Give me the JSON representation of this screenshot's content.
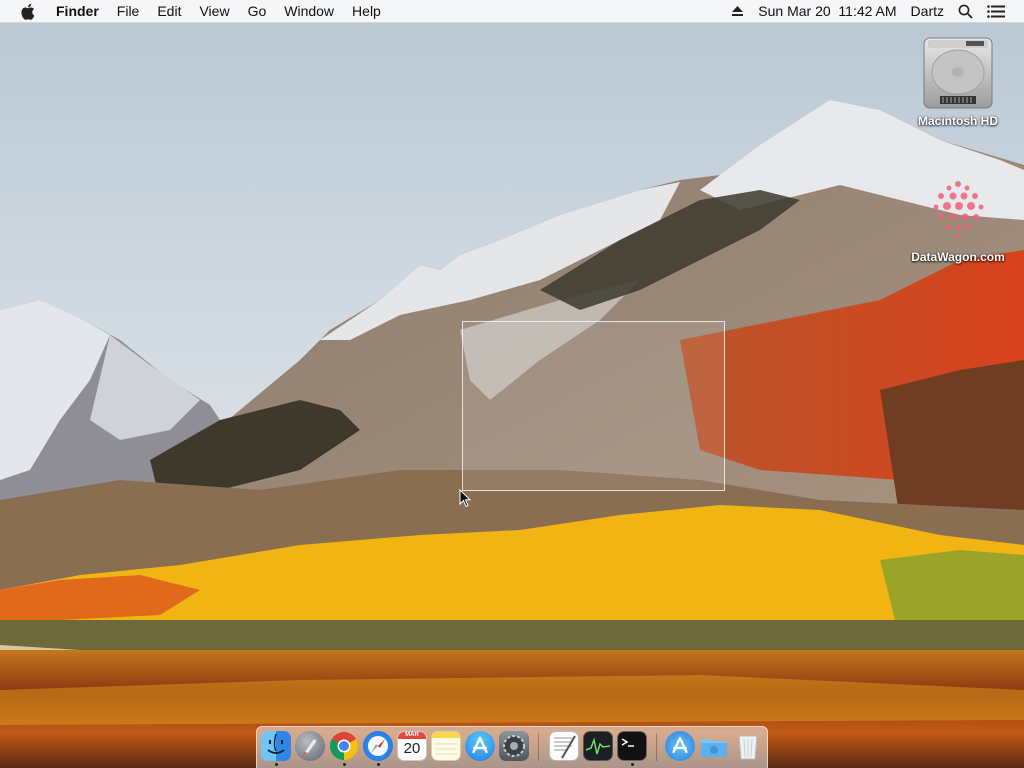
{
  "menubar": {
    "app_name": "Finder",
    "menus": [
      "File",
      "Edit",
      "View",
      "Go",
      "Window",
      "Help"
    ],
    "clock": "Sun Mar 20  11:42 AM",
    "user": "Dartz"
  },
  "desktop": {
    "icons": [
      {
        "label": "Macintosh HD",
        "icon": "hard-drive-icon"
      },
      {
        "label": "DataWagon.com",
        "icon": "datawagon-logo-icon"
      }
    ]
  },
  "dock": {
    "calendar_day": "20",
    "calendar_month": "MAR",
    "apps": [
      {
        "name": "Finder",
        "icon": "finder-icon",
        "running": true
      },
      {
        "name": "Launchpad",
        "icon": "launchpad-icon",
        "running": false
      },
      {
        "name": "Google Chrome",
        "icon": "chrome-icon",
        "running": true
      },
      {
        "name": "Safari",
        "icon": "safari-icon",
        "running": true
      },
      {
        "name": "Calendar",
        "icon": "calendar-icon",
        "running": false
      },
      {
        "name": "Notes",
        "icon": "notes-icon",
        "running": false
      },
      {
        "name": "App Store",
        "icon": "app-store-icon",
        "running": false
      },
      {
        "name": "System Preferences",
        "icon": "system-preferences-icon",
        "running": false
      },
      {
        "name": "TextEdit",
        "icon": "textedit-icon",
        "running": false
      },
      {
        "name": "Activity Monitor",
        "icon": "activity-monitor-icon",
        "running": false
      },
      {
        "name": "Terminal",
        "icon": "terminal-icon",
        "running": true
      },
      {
        "name": "Applications",
        "icon": "applications-folder-icon",
        "running": false
      },
      {
        "name": "Downloads",
        "icon": "downloads-folder-icon",
        "running": false
      },
      {
        "name": "Trash",
        "icon": "trash-icon",
        "running": false
      }
    ]
  },
  "colors": {
    "sky": "#c9d5de",
    "autumn_yellow": "#f3b611",
    "autumn_red": "#d9441d",
    "menubar_bg": "#f8f8f8"
  }
}
